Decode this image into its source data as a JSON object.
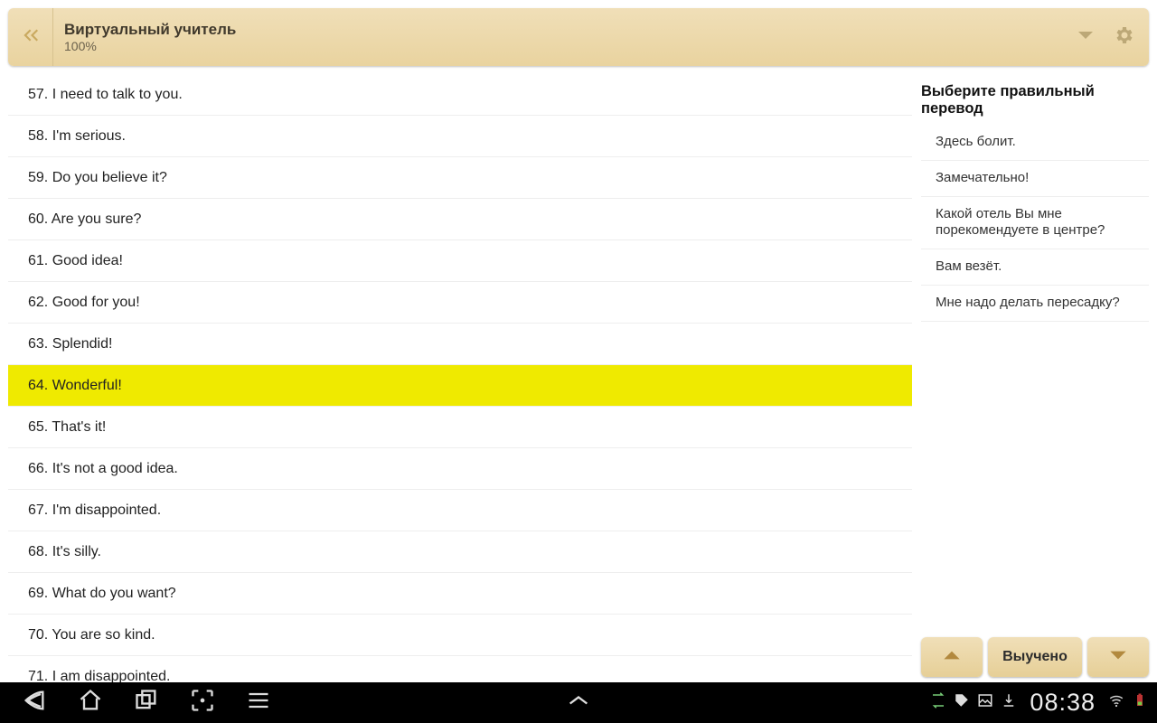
{
  "header": {
    "title": "Виртуальный учитель",
    "progress": "100%"
  },
  "phrases": [
    {
      "num": "57",
      "text": "I need to talk to you.",
      "selected": false
    },
    {
      "num": "58",
      "text": "I'm serious.",
      "selected": false
    },
    {
      "num": "59",
      "text": "Do you believe it?",
      "selected": false
    },
    {
      "num": "60",
      "text": "Are you sure?",
      "selected": false
    },
    {
      "num": "61",
      "text": "Good idea!",
      "selected": false
    },
    {
      "num": "62",
      "text": "Good for you!",
      "selected": false
    },
    {
      "num": "63",
      "text": "Splendid!",
      "selected": false
    },
    {
      "num": "64",
      "text": "Wonderful!",
      "selected": true
    },
    {
      "num": "65",
      "text": "That's it!",
      "selected": false
    },
    {
      "num": "66",
      "text": "It's not a good idea.",
      "selected": false
    },
    {
      "num": "67",
      "text": "I'm disappointed.",
      "selected": false
    },
    {
      "num": "68",
      "text": "It's silly.",
      "selected": false
    },
    {
      "num": "69",
      "text": "What do you want?",
      "selected": false
    },
    {
      "num": "70",
      "text": "You are so kind.",
      "selected": false
    },
    {
      "num": "71",
      "text": "I am disappointed.",
      "selected": false
    }
  ],
  "rightPanel": {
    "prompt": "Выберите правильный перевод",
    "options": [
      "Здесь болит.",
      "Замечательно!",
      "Какой отель Вы мне порекомендуете в центре?",
      "Вам везёт.",
      "Мне надо делать пересадку?"
    ],
    "learned_label": "Выучено"
  },
  "statusbar": {
    "time": "08:38"
  }
}
